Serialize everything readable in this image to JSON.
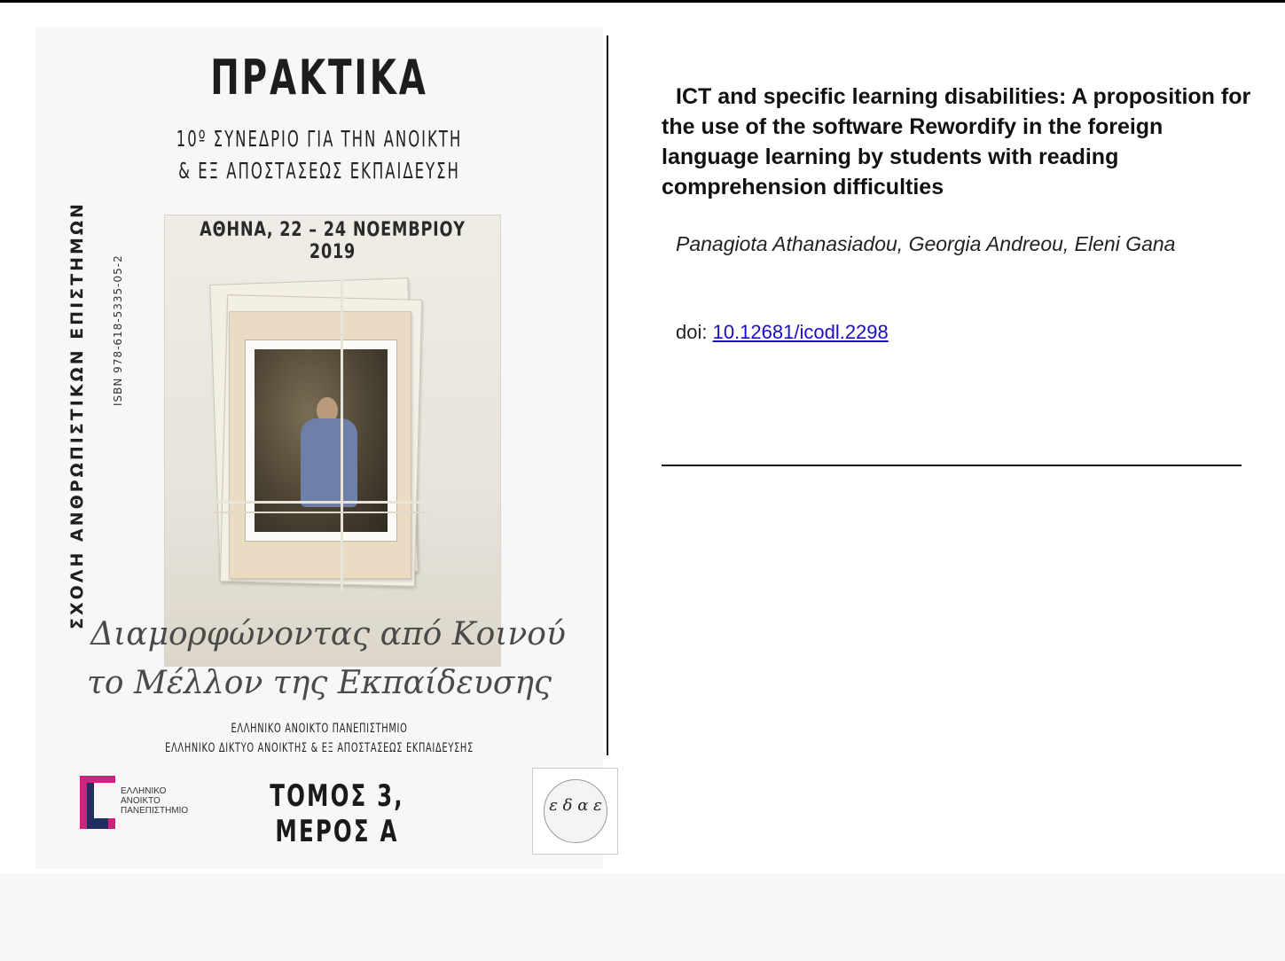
{
  "cover": {
    "title": "ΠΡΑΚΤΙΚΑ",
    "conference_line1": "10º ΣΥΝΕΔΡΙΟ ΓΙΑ ΤΗΝ ΑΝΟΙΚΤΗ",
    "conference_line2": "& ΕΞ ΑΠΟΣΤΑΣΕΩΣ ΕΚΠΑΙΔΕΥΣΗ",
    "school": "ΣΧΟΛΗ ΑΝΘΡΩΠΙΣΤΙΚΩΝ ΕΠΙΣΤΗΜΩΝ",
    "isbn": "ISBN 978-618-5335-05-2",
    "date_place": "ΑΘΗΝΑ, 22 – 24 ΝΟΕΜΒΡΙΟΥ 2019",
    "theme_line1": "Διαμορφώνοντας από Κοινού",
    "theme_line2": "το Μέλλον της Εκπαίδευσης",
    "org_line1": "ΕΛΛΗΝΙΚΟ ΑΝΟΙΚΤΟ ΠΑΝΕΠΙΣΤΗΜΙΟ",
    "org_line2": "ΕΛΛΗΝΙΚΟ ΔΙΚΤΥΟ ΑΝΟΙΚΤΗΣ & ΕΞ ΑΠΟΣΤΑΣΕΩΣ ΕΚΠΑΙΔΕΥΣΗΣ",
    "volume": "ΤΟΜΟΣ 3, ΜΕΡΟΣ Α",
    "eap_logo_text": [
      "ΕΛΛΗΝΙΚΟ",
      "ΑΝΟΙΚΤΟ",
      "ΠΑΝΕΠΙΣΤΗΜΙΟ"
    ],
    "edae_logo_glyphs": "ε δ α ε"
  },
  "article": {
    "title": "ICT and specific learning disabilities: A proposition for the use of the software Rewordify in the foreign language learning by students with reading comprehension difficulties",
    "authors": "Panagiota Athanasiadou, Georgia Andreou, Eleni Gana",
    "doi_label": "doi: ",
    "doi": "10.12681/icodl.2298"
  },
  "colors": {
    "link": "#1a0dcc",
    "eap_magenta": "#d61f7c",
    "eap_navy": "#1f2f5e"
  }
}
